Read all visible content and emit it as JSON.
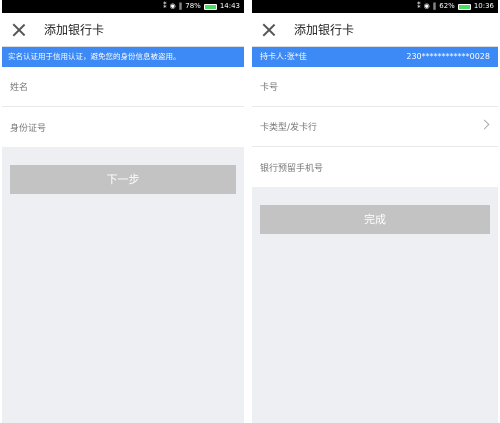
{
  "left": {
    "status": {
      "icons": [
        "⁑",
        "◉",
        "‖"
      ],
      "battery_pct": "78%",
      "time": "14:43"
    },
    "title": "添加银行卡",
    "notice": "实名认证用于信用认证，避免您的身份信息被盗用。",
    "fields": [
      {
        "label": "姓名"
      },
      {
        "label": "身份证号"
      }
    ],
    "button": "下一步"
  },
  "right": {
    "status": {
      "icons": [
        "⁑",
        "◉",
        "‖"
      ],
      "battery_pct": "62%",
      "time": "10:36"
    },
    "title": "添加银行卡",
    "holder_label": "持卡人:张*佳",
    "holder_id": "230************0028",
    "fields": [
      {
        "label": "卡号"
      },
      {
        "label": "卡类型/发卡行"
      },
      {
        "label": "银行预留手机号"
      }
    ],
    "button": "完成"
  },
  "colors": {
    "accent": "#3d8af7",
    "button_disabled": "#c3c3c3",
    "background": "#eeeff3"
  }
}
